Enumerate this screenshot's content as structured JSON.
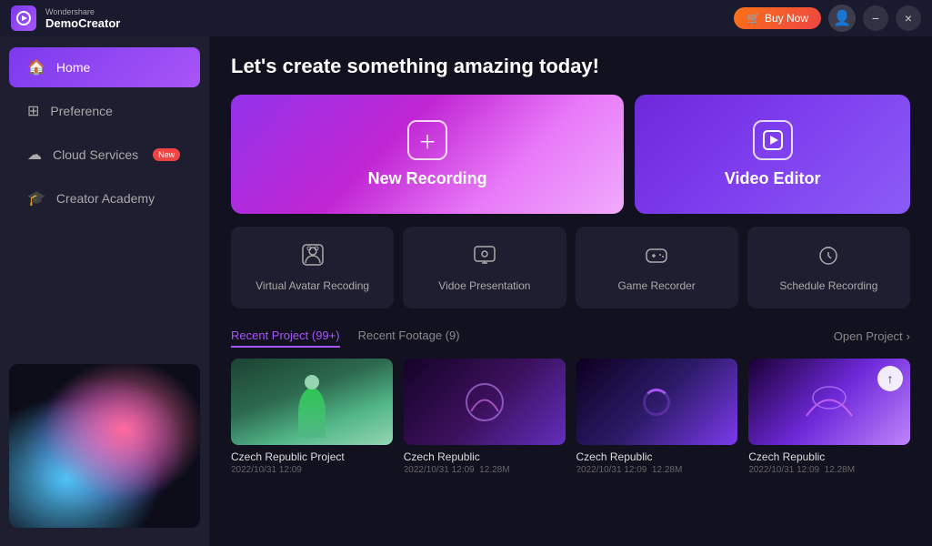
{
  "titlebar": {
    "brand_name_top": "Wondershare",
    "brand_name_bottom": "DemoCreator",
    "buy_now_label": "Buy Now",
    "minimize_label": "−",
    "close_label": "×"
  },
  "sidebar": {
    "items": [
      {
        "id": "home",
        "label": "Home",
        "icon": "🏠",
        "active": true
      },
      {
        "id": "preference",
        "label": "Preference",
        "icon": "⊞"
      },
      {
        "id": "cloud-services",
        "label": "Cloud Services",
        "icon": "☁",
        "badge": "New"
      },
      {
        "id": "creator-academy",
        "label": "Creator Academy",
        "icon": "🎓"
      }
    ]
  },
  "content": {
    "page_title": "Let's create something amazing today!",
    "hero_cards": [
      {
        "id": "new-recording",
        "label": "New Recording",
        "icon": "+"
      },
      {
        "id": "video-editor",
        "label": "Video Editor",
        "icon": "▶"
      }
    ],
    "feature_cards": [
      {
        "id": "virtual-avatar",
        "label": "Virtual Avatar Recoding",
        "icon": "👤"
      },
      {
        "id": "video-presentation",
        "label": "Vidoe Presentation",
        "icon": "🖼"
      },
      {
        "id": "game-recorder",
        "label": "Game Recorder",
        "icon": "🎮"
      },
      {
        "id": "schedule-recording",
        "label": "Schedule Recording",
        "icon": "⏰"
      }
    ],
    "recent_tabs": [
      {
        "id": "recent-project",
        "label": "Recent Project (99+)",
        "active": true
      },
      {
        "id": "recent-footage",
        "label": "Recent Footage (9)",
        "active": false
      }
    ],
    "open_project_label": "Open Project",
    "projects": [
      {
        "id": "project-1",
        "name": "Czech Republic Project",
        "date": "2022/10/31 12:09",
        "size": "",
        "type": "green-scene"
      },
      {
        "id": "project-2",
        "name": "Czech Republic",
        "date": "2022/10/31 12:09",
        "size": "12.28M",
        "type": "purple-wave"
      },
      {
        "id": "project-3",
        "name": "Czech Republic",
        "date": "2022/10/31 12:09",
        "size": "12.28M",
        "type": "purple-light",
        "loading": true
      },
      {
        "id": "project-4",
        "name": "Czech Republic",
        "date": "2022/10/31 12:09",
        "size": "12.28M",
        "type": "purple-cloud",
        "upload": true
      }
    ]
  }
}
